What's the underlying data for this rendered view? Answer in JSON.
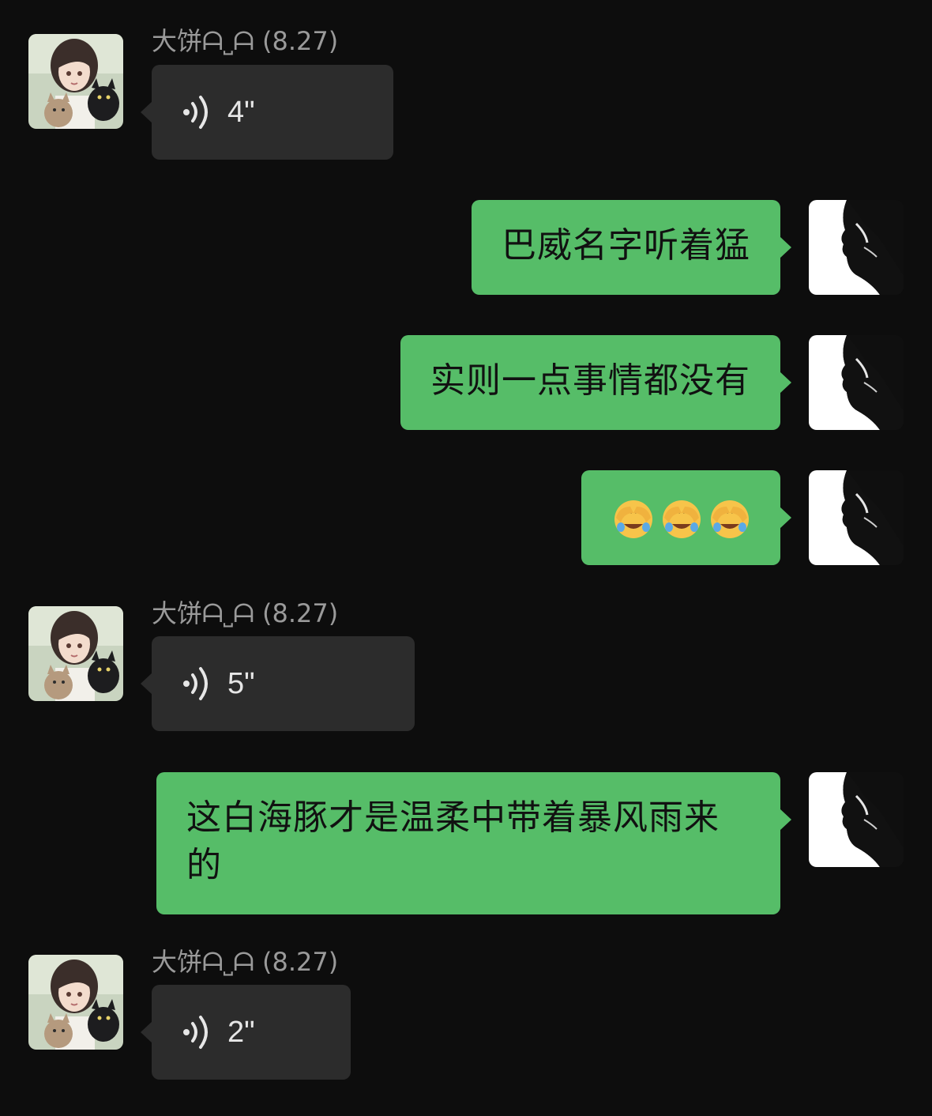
{
  "chat": {
    "messages": [
      {
        "id": "m1",
        "direction": "in",
        "sender": "大饼ᗩ˽ᗩ (8.27)",
        "type": "voice",
        "duration": "4\""
      },
      {
        "id": "m2",
        "direction": "out",
        "type": "text",
        "text": "巴威名字听着猛"
      },
      {
        "id": "m3",
        "direction": "out",
        "type": "text",
        "text": "实则一点事情都没有"
      },
      {
        "id": "m4",
        "direction": "out",
        "type": "emoji",
        "emoji": [
          "face-palm-crying-emoji",
          "face-palm-crying-emoji",
          "face-palm-crying-emoji"
        ]
      },
      {
        "id": "m5",
        "direction": "in",
        "sender": "大饼ᗩ˽ᗩ (8.27)",
        "type": "voice",
        "duration": "5\""
      },
      {
        "id": "m6",
        "direction": "out",
        "type": "text",
        "text": "这白海豚才是温柔中带着暴风雨来的"
      },
      {
        "id": "m7",
        "direction": "in",
        "sender": "大饼ᗩ˽ᗩ (8.27)",
        "type": "voice",
        "duration": "2\""
      }
    ]
  },
  "colors": {
    "background": "#0d0d0d",
    "incoming_bubble": "#2c2c2c",
    "outgoing_bubble": "#56bd68",
    "sender_name": "#9a9a9a"
  },
  "icons": {
    "voice": "voice-wave-icon",
    "avatar_in": "anime-girl-with-cats-avatar",
    "avatar_out": "silhouette-profile-avatar"
  }
}
